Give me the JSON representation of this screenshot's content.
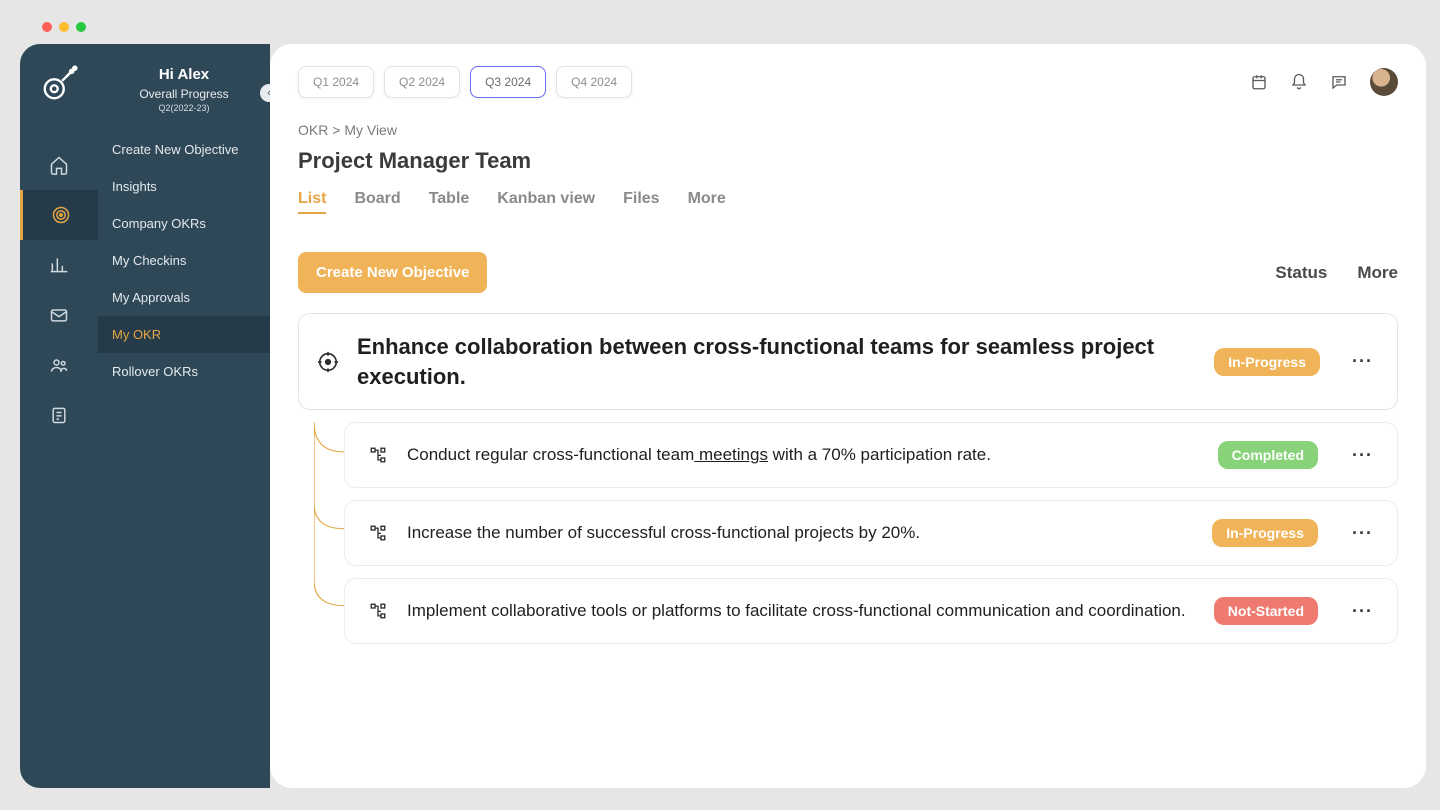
{
  "window": {
    "dots": [
      "red",
      "yellow",
      "green"
    ]
  },
  "side": {
    "hi": "Hi Alex",
    "sub": "Overall Progress",
    "sub2": "Q2(2022-23)",
    "items": [
      "Create New Objective",
      "Insights",
      "Company OKRs",
      "My  Checkins",
      "My Approvals",
      "My OKR",
      "Rollover OKRs"
    ],
    "active_index": 5
  },
  "rail": {
    "active_index": 1
  },
  "quarters": {
    "items": [
      "Q1 2024",
      "Q2 2024",
      "Q3 2024",
      "Q4 2024"
    ],
    "active_index": 2
  },
  "breadcrumb": {
    "root": "OKR",
    "sep": ">",
    "leaf": "My View"
  },
  "page_title": "Project Manager Team",
  "views": {
    "items": [
      "List",
      "Board",
      "Table",
      "Kanban view",
      "Files",
      "More"
    ],
    "active_index": 0
  },
  "actions": {
    "create": "Create New Objective",
    "status": "Status",
    "more": "More"
  },
  "objective": {
    "title": "Enhance collaboration between cross-functional teams for seamless project execution.",
    "status": "In-Progress",
    "status_class": "progress"
  },
  "key_results": [
    {
      "pre": "Conduct regular cross-functional team",
      "ul": " meetings",
      "post": " with a 70% participation rate.",
      "status": "Completed",
      "status_class": "completed"
    },
    {
      "pre": "Increase the number of successful cross-functional projects by 20%.",
      "ul": "",
      "post": "",
      "status": "In-Progress",
      "status_class": "progress"
    },
    {
      "pre": "Implement collaborative tools or platforms to facilitate cross-functional communication and coordination.",
      "ul": "",
      "post": "",
      "status": "Not-Started",
      "status_class": "notstarted"
    }
  ]
}
